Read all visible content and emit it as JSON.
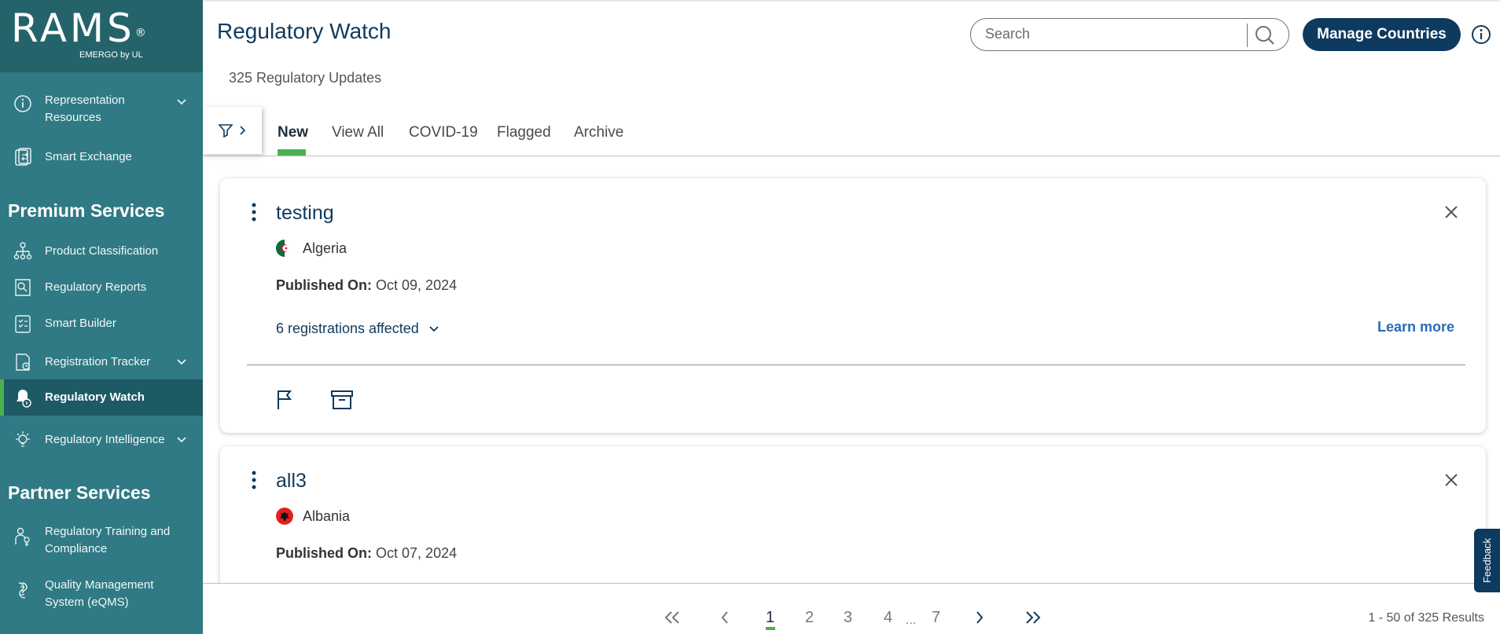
{
  "app": {
    "logo": "RAMS",
    "logo_mark": "®",
    "logo_sub": "EMERGO by UL"
  },
  "sidebar": {
    "items_top": [
      {
        "label": "Representation Resources",
        "icon": "info-circle-icon",
        "expandable": true
      },
      {
        "label": "Smart Exchange",
        "icon": "exchange-doc-icon",
        "expandable": false
      }
    ],
    "premium_heading": "Premium Services",
    "premium_items": [
      {
        "label": "Product Classification",
        "icon": "hierarchy-icon",
        "expandable": false
      },
      {
        "label": "Regulatory Reports",
        "icon": "report-search-icon",
        "expandable": false
      },
      {
        "label": "Smart Builder",
        "icon": "checklist-icon",
        "expandable": false
      },
      {
        "label": "Registration Tracker",
        "icon": "tracker-icon",
        "expandable": true
      },
      {
        "label": "Regulatory Watch",
        "icon": "bell-watch-icon",
        "expandable": false,
        "active": true
      },
      {
        "label": "Regulatory Intelligence",
        "icon": "bulb-icon",
        "expandable": true
      }
    ],
    "partner_heading": "Partner Services",
    "partner_items": [
      {
        "label": "Regulatory Training and Compliance",
        "icon": "trainer-icon",
        "expandable": false
      },
      {
        "label": "Quality Management System (eQMS)",
        "icon": "qms-icon",
        "expandable": false
      }
    ]
  },
  "header": {
    "title": "Regulatory Watch",
    "count_text": "325 Regulatory Updates",
    "search_placeholder": "Search",
    "manage_label": "Manage Countries"
  },
  "tabs": [
    "New",
    "View All",
    "COVID-19",
    "Flagged",
    "Archive"
  ],
  "active_tab": "New",
  "cards": [
    {
      "title": "testing",
      "country": "Algeria",
      "published_label": "Published On:",
      "published_date": "Oct 09, 2024",
      "registrations": "6 registrations affected",
      "learn_more": "Learn more"
    },
    {
      "title": "all3",
      "country": "Albania",
      "published_label": "Published On:",
      "published_date": "Oct 07, 2024"
    }
  ],
  "pagination": {
    "pages": [
      "1",
      "2",
      "3",
      "4",
      "7"
    ],
    "ellipsis": "...",
    "current": "1",
    "results": "1 - 50 of 325 Results"
  },
  "feedback_label": "Feedback",
  "colors": {
    "sidebar": "#2f7a84",
    "sidebar_dark": "#25636b",
    "navy": "#0e3a5f",
    "accent_green": "#4caf50",
    "link_blue": "#2a6bb5"
  }
}
